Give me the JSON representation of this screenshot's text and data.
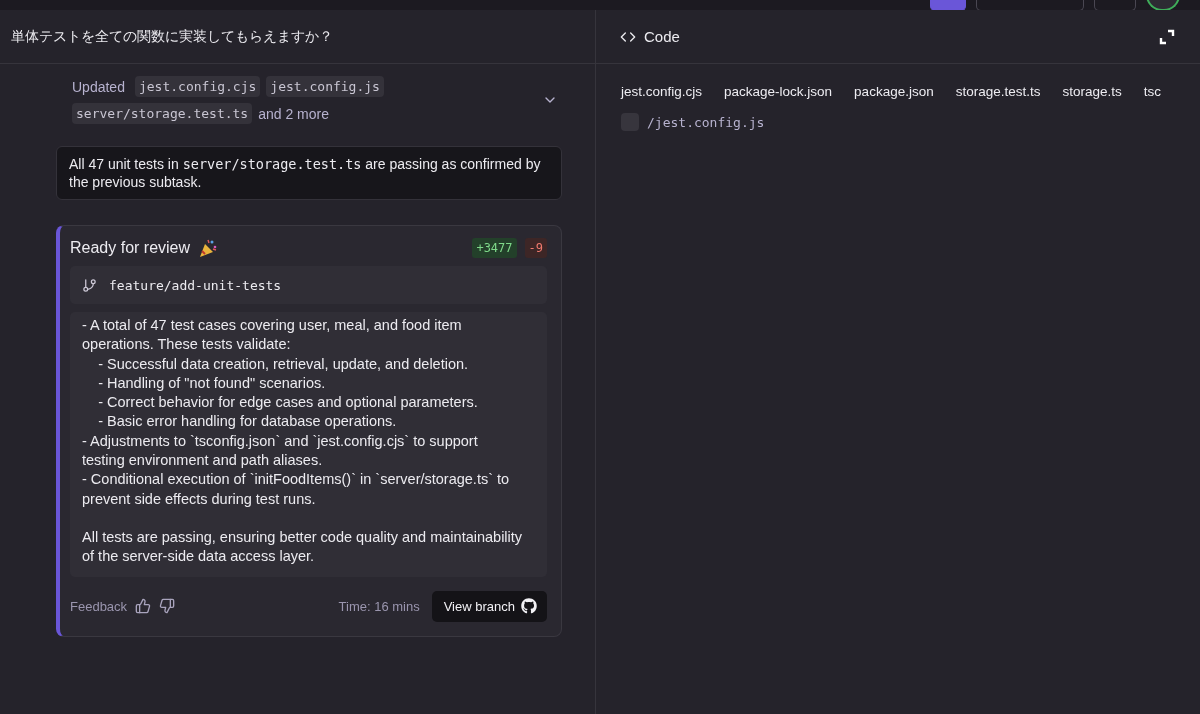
{
  "chat": {
    "prompt": "単体テストを全ての関数に実装してもらえますか？",
    "updated": {
      "label": "Updated",
      "files": [
        "jest.config.cjs",
        "jest.config.js",
        "server/storage.test.ts"
      ],
      "more": "and 2 more",
      "expanded": false
    },
    "note": {
      "before": "All 47 unit tests in",
      "code": "server/storage.test.ts",
      "after": "are passing as confirmed by the previous subtask."
    },
    "review": {
      "title": "Ready for review",
      "additions": "+3477",
      "deletions": "-9",
      "branch": "feature/add-unit-tests",
      "summary": {
        "lines": [
          "- A total of 47 test cases covering user, meal, and food item operations. These tests validate:",
          "    - Successful data creation, retrieval, update, and deletion.",
          "    - Handling of \"not found\" scenarios.",
          "    - Correct behavior for edge cases and optional parameters.",
          "    - Basic error handling for database operations.",
          "- Adjustments to `tsconfig.json` and `jest.config.cjs` to support testing environment and path aliases.",
          "- Conditional execution of `initFoodItems()` in `server/storage.ts` to prevent side effects during test runs."
        ],
        "conclusion": "All tests are passing, ensuring better code quality and maintainability of the server-side data access layer."
      },
      "feedback": "Feedback",
      "time": "Time: 16 mins",
      "button": "View branch"
    }
  },
  "code": {
    "title": "Code",
    "tabs": [
      "jest.config.cjs",
      "package-lock.json",
      "package.json",
      "storage.test.ts",
      "storage.ts",
      "tsc"
    ],
    "file": {
      "path": "/jest.config.js",
      "checked": false
    }
  }
}
